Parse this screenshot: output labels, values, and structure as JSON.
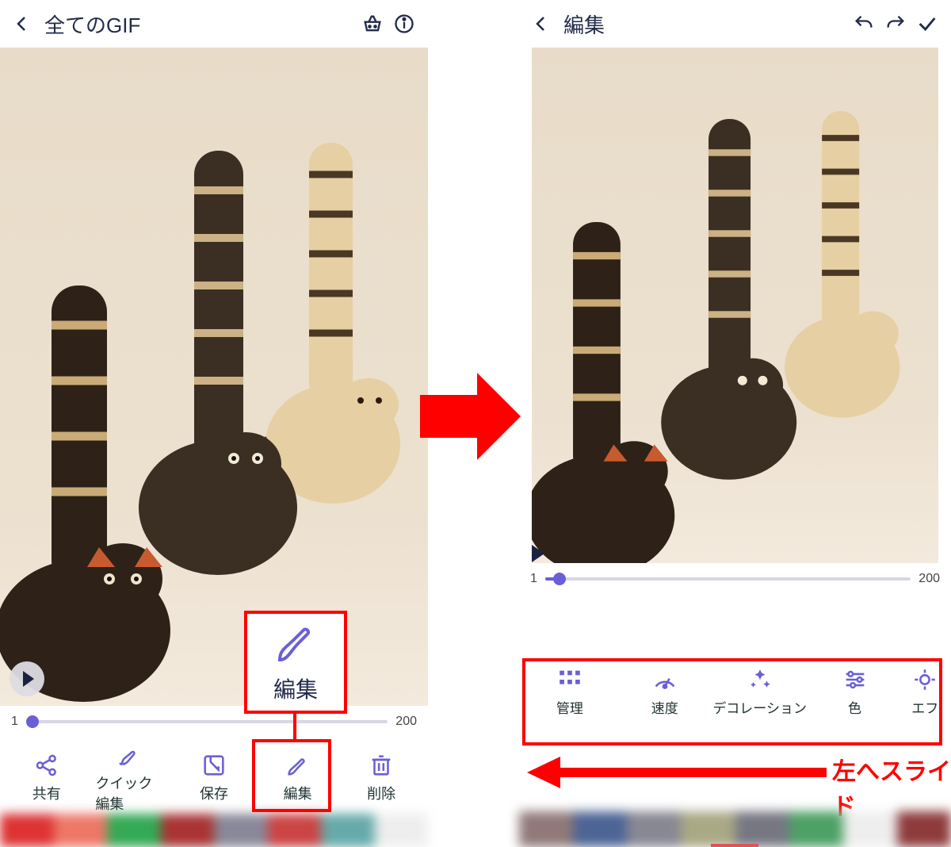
{
  "left": {
    "header": {
      "title": "全てのGIF"
    },
    "slider": {
      "min": "1",
      "max": "200"
    },
    "toolbar": [
      {
        "id": "share",
        "label": "共有"
      },
      {
        "id": "quick-edit",
        "label": "クイック編集"
      },
      {
        "id": "save",
        "label": "保存"
      },
      {
        "id": "edit",
        "label": "編集"
      },
      {
        "id": "delete",
        "label": "削除"
      }
    ],
    "callout": {
      "label": "編集"
    }
  },
  "right": {
    "header": {
      "title": "編集"
    },
    "slider": {
      "min": "1",
      "max": "200"
    },
    "toolbar": [
      {
        "id": "manage",
        "label": "管理"
      },
      {
        "id": "speed",
        "label": "速度"
      },
      {
        "id": "decoration",
        "label": "デコレーション"
      },
      {
        "id": "color",
        "label": "色"
      },
      {
        "id": "effect",
        "label": "エフ"
      }
    ],
    "slide_hint": "左へスライド"
  },
  "colors": {
    "accent": "#6b5fd6",
    "annotation": "#ff0000",
    "ink": "#222b4a"
  }
}
